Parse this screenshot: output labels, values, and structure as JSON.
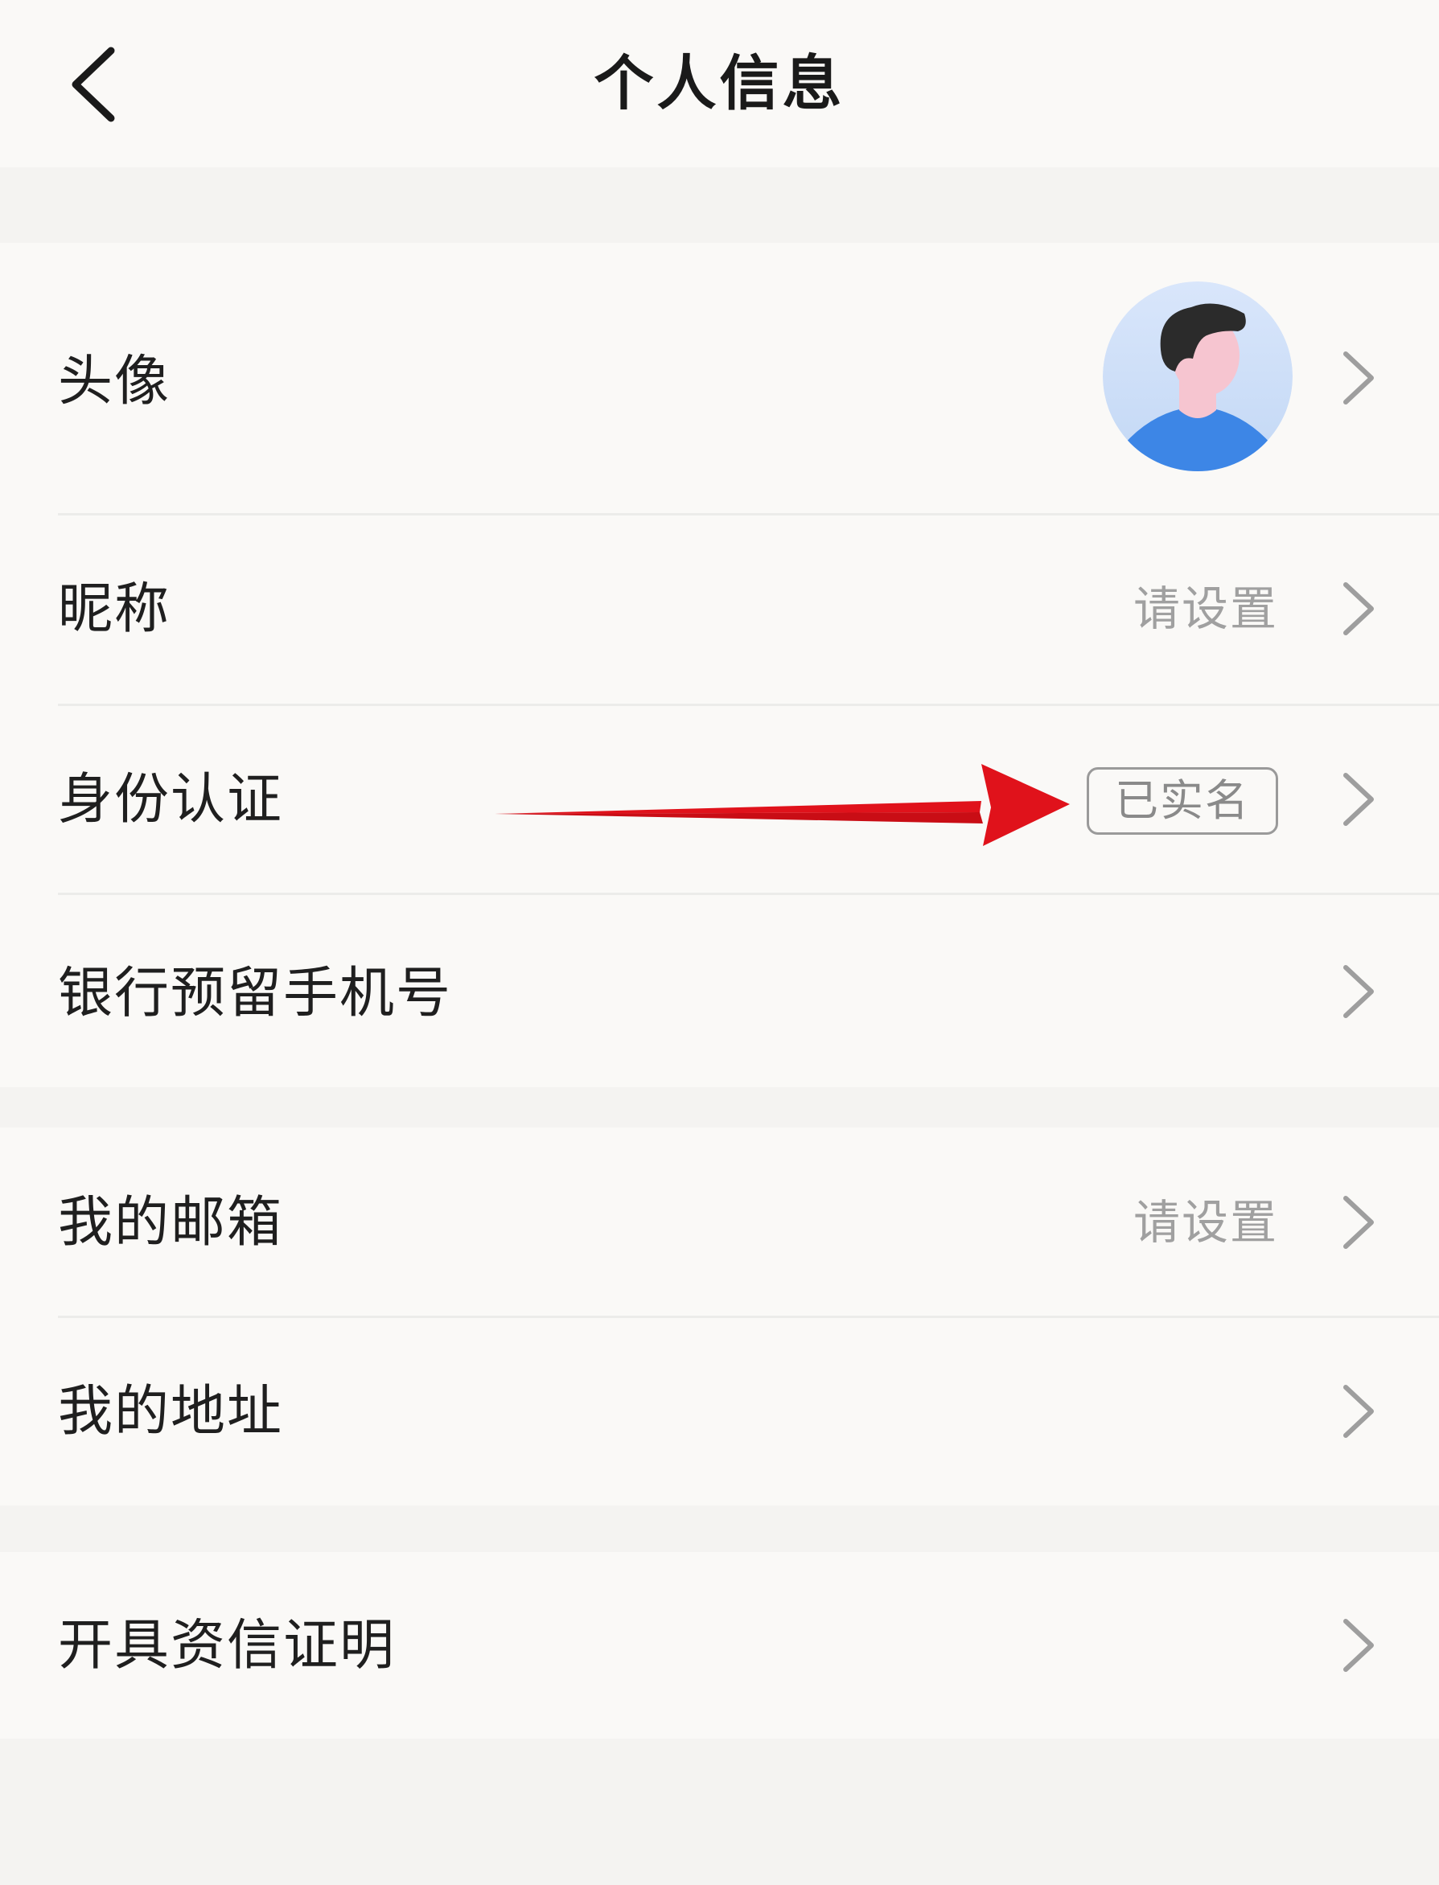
{
  "header": {
    "title": "个人信息",
    "back_icon": "chevron-left-icon"
  },
  "rows": [
    {
      "id": "avatar",
      "label": "头像",
      "value": "",
      "icon": "avatar-image"
    },
    {
      "id": "nickname",
      "label": "昵称",
      "value": "请设置"
    },
    {
      "id": "identity",
      "label": "身份认证",
      "badge": "已实名"
    },
    {
      "id": "bank-phone",
      "label": "银行预留手机号",
      "value": ""
    },
    {
      "id": "email",
      "label": "我的邮箱",
      "value": "请设置"
    },
    {
      "id": "address",
      "label": "我的地址",
      "value": ""
    },
    {
      "id": "credit-proof",
      "label": "开具资信证明",
      "value": ""
    }
  ],
  "annotation": {
    "color": "#e0121b",
    "icon": "red-arrow-annotation"
  },
  "colors": {
    "background": "#f4f3f1",
    "card": "#faf9f7",
    "text": "#1f1f1f",
    "muted": "#a0a0a0",
    "avatar_shirt": "#3d86e6",
    "avatar_hair": "#2b2b2b",
    "avatar_skin": "#f6c5d0"
  }
}
